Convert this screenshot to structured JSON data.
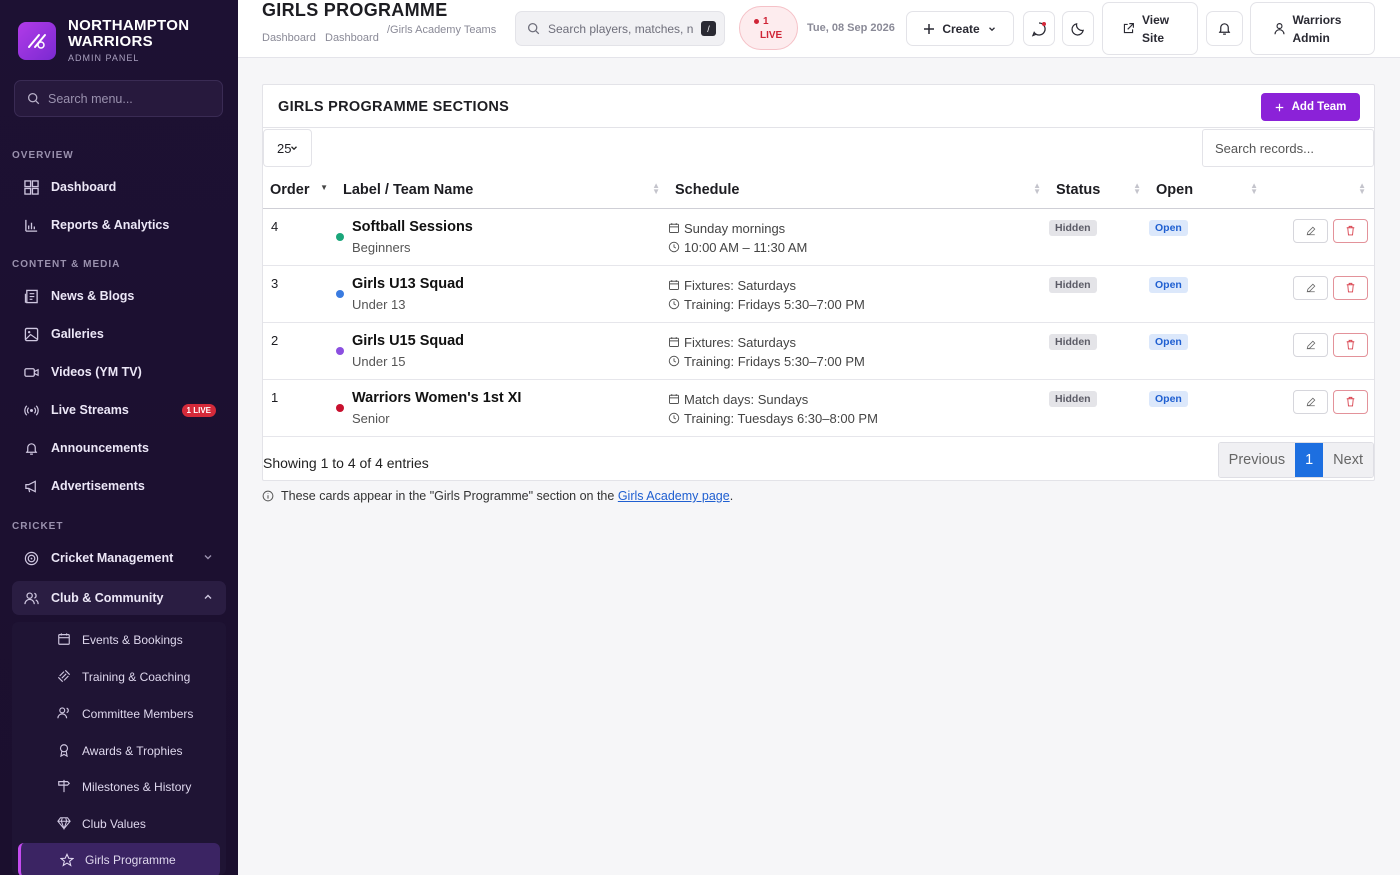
{
  "brand": {
    "name": "NORTHAMPTON WARRIORS",
    "name_line1": "NORTHAMPTON",
    "name_line2": "WARRIORS",
    "subtitle": "ADMIN PANEL"
  },
  "sidebar": {
    "search_placeholder": "Search menu...",
    "sections": {
      "overview": "OVERVIEW",
      "content": "CONTENT & MEDIA",
      "cricket": "CRICKET"
    },
    "items": {
      "dashboard": "Dashboard",
      "reports": "Reports & Analytics",
      "news": "News & Blogs",
      "galleries": "Galleries",
      "videos": "Videos (YM TV)",
      "live": "Live Streams",
      "live_badge": "1 LIVE",
      "announcements": "Announcements",
      "ads": "Advertisements",
      "cricket_mgmt": "Cricket Management",
      "club": "Club & Community"
    },
    "sub_items": [
      "Events & Bookings",
      "Training & Coaching",
      "Committee Members",
      "Awards & Trophies",
      "Milestones & History",
      "Club Values",
      "Girls Programme"
    ]
  },
  "header": {
    "title": "GIRLS PROGRAMME",
    "crumbs": [
      "Dashboard",
      "Dashboard",
      "/Girls Academy Teams"
    ],
    "search_placeholder": "Search players, matches, n",
    "kbd": "/",
    "live_count": "1",
    "live_label": "LIVE",
    "date": "Tue, 08 Sep 2026",
    "create": "Create",
    "view_site": "View Site",
    "user": "Warriors Admin"
  },
  "panel": {
    "title": "GIRLS PROGRAMME SECTIONS",
    "add_button": "Add Team",
    "page_length": "25",
    "search_placeholder": "Search records...",
    "columns": [
      "Order",
      "Label / Team Name",
      "Schedule",
      "Status",
      "Open"
    ],
    "rows": [
      {
        "order": "4",
        "name": "Softball Sessions",
        "sub": "Beginners",
        "dot": "#1aa67a",
        "sched1": "Sunday mornings",
        "sched2": "10:00 AM – 11:30 AM",
        "status": "Hidden",
        "open": "Open"
      },
      {
        "order": "3",
        "name": "Girls U13 Squad",
        "sub": "Under 13",
        "dot": "#3a7be0",
        "sched1": "Fixtures: Saturdays",
        "sched2": "Training: Fridays 5:30–7:00 PM",
        "status": "Hidden",
        "open": "Open"
      },
      {
        "order": "2",
        "name": "Girls U15 Squad",
        "sub": "Under 15",
        "dot": "#8b4fe0",
        "sched1": "Fixtures: Saturdays",
        "sched2": "Training: Fridays 5:30–7:00 PM",
        "status": "Hidden",
        "open": "Open"
      },
      {
        "order": "1",
        "name": "Warriors Women's 1st XI",
        "sub": "Senior",
        "dot": "#c8102e",
        "sched1": "Match days: Sundays",
        "sched2": "Training: Tuesdays 6:30–8:00 PM",
        "status": "Hidden",
        "open": "Open"
      }
    ],
    "info": "Showing 1 to 4 of 4 entries",
    "pager": {
      "prev": "Previous",
      "current": "1",
      "next": "Next"
    }
  },
  "note": {
    "text": "These cards appear in the \"Girls Programme\" section on the",
    "link": "Girls Academy page",
    "end": "."
  },
  "colors": {
    "accent": "#8b22d8",
    "sidebar_bg": "#1d1133",
    "live": "#d42a3a",
    "pager_active": "#1d6fe0"
  }
}
